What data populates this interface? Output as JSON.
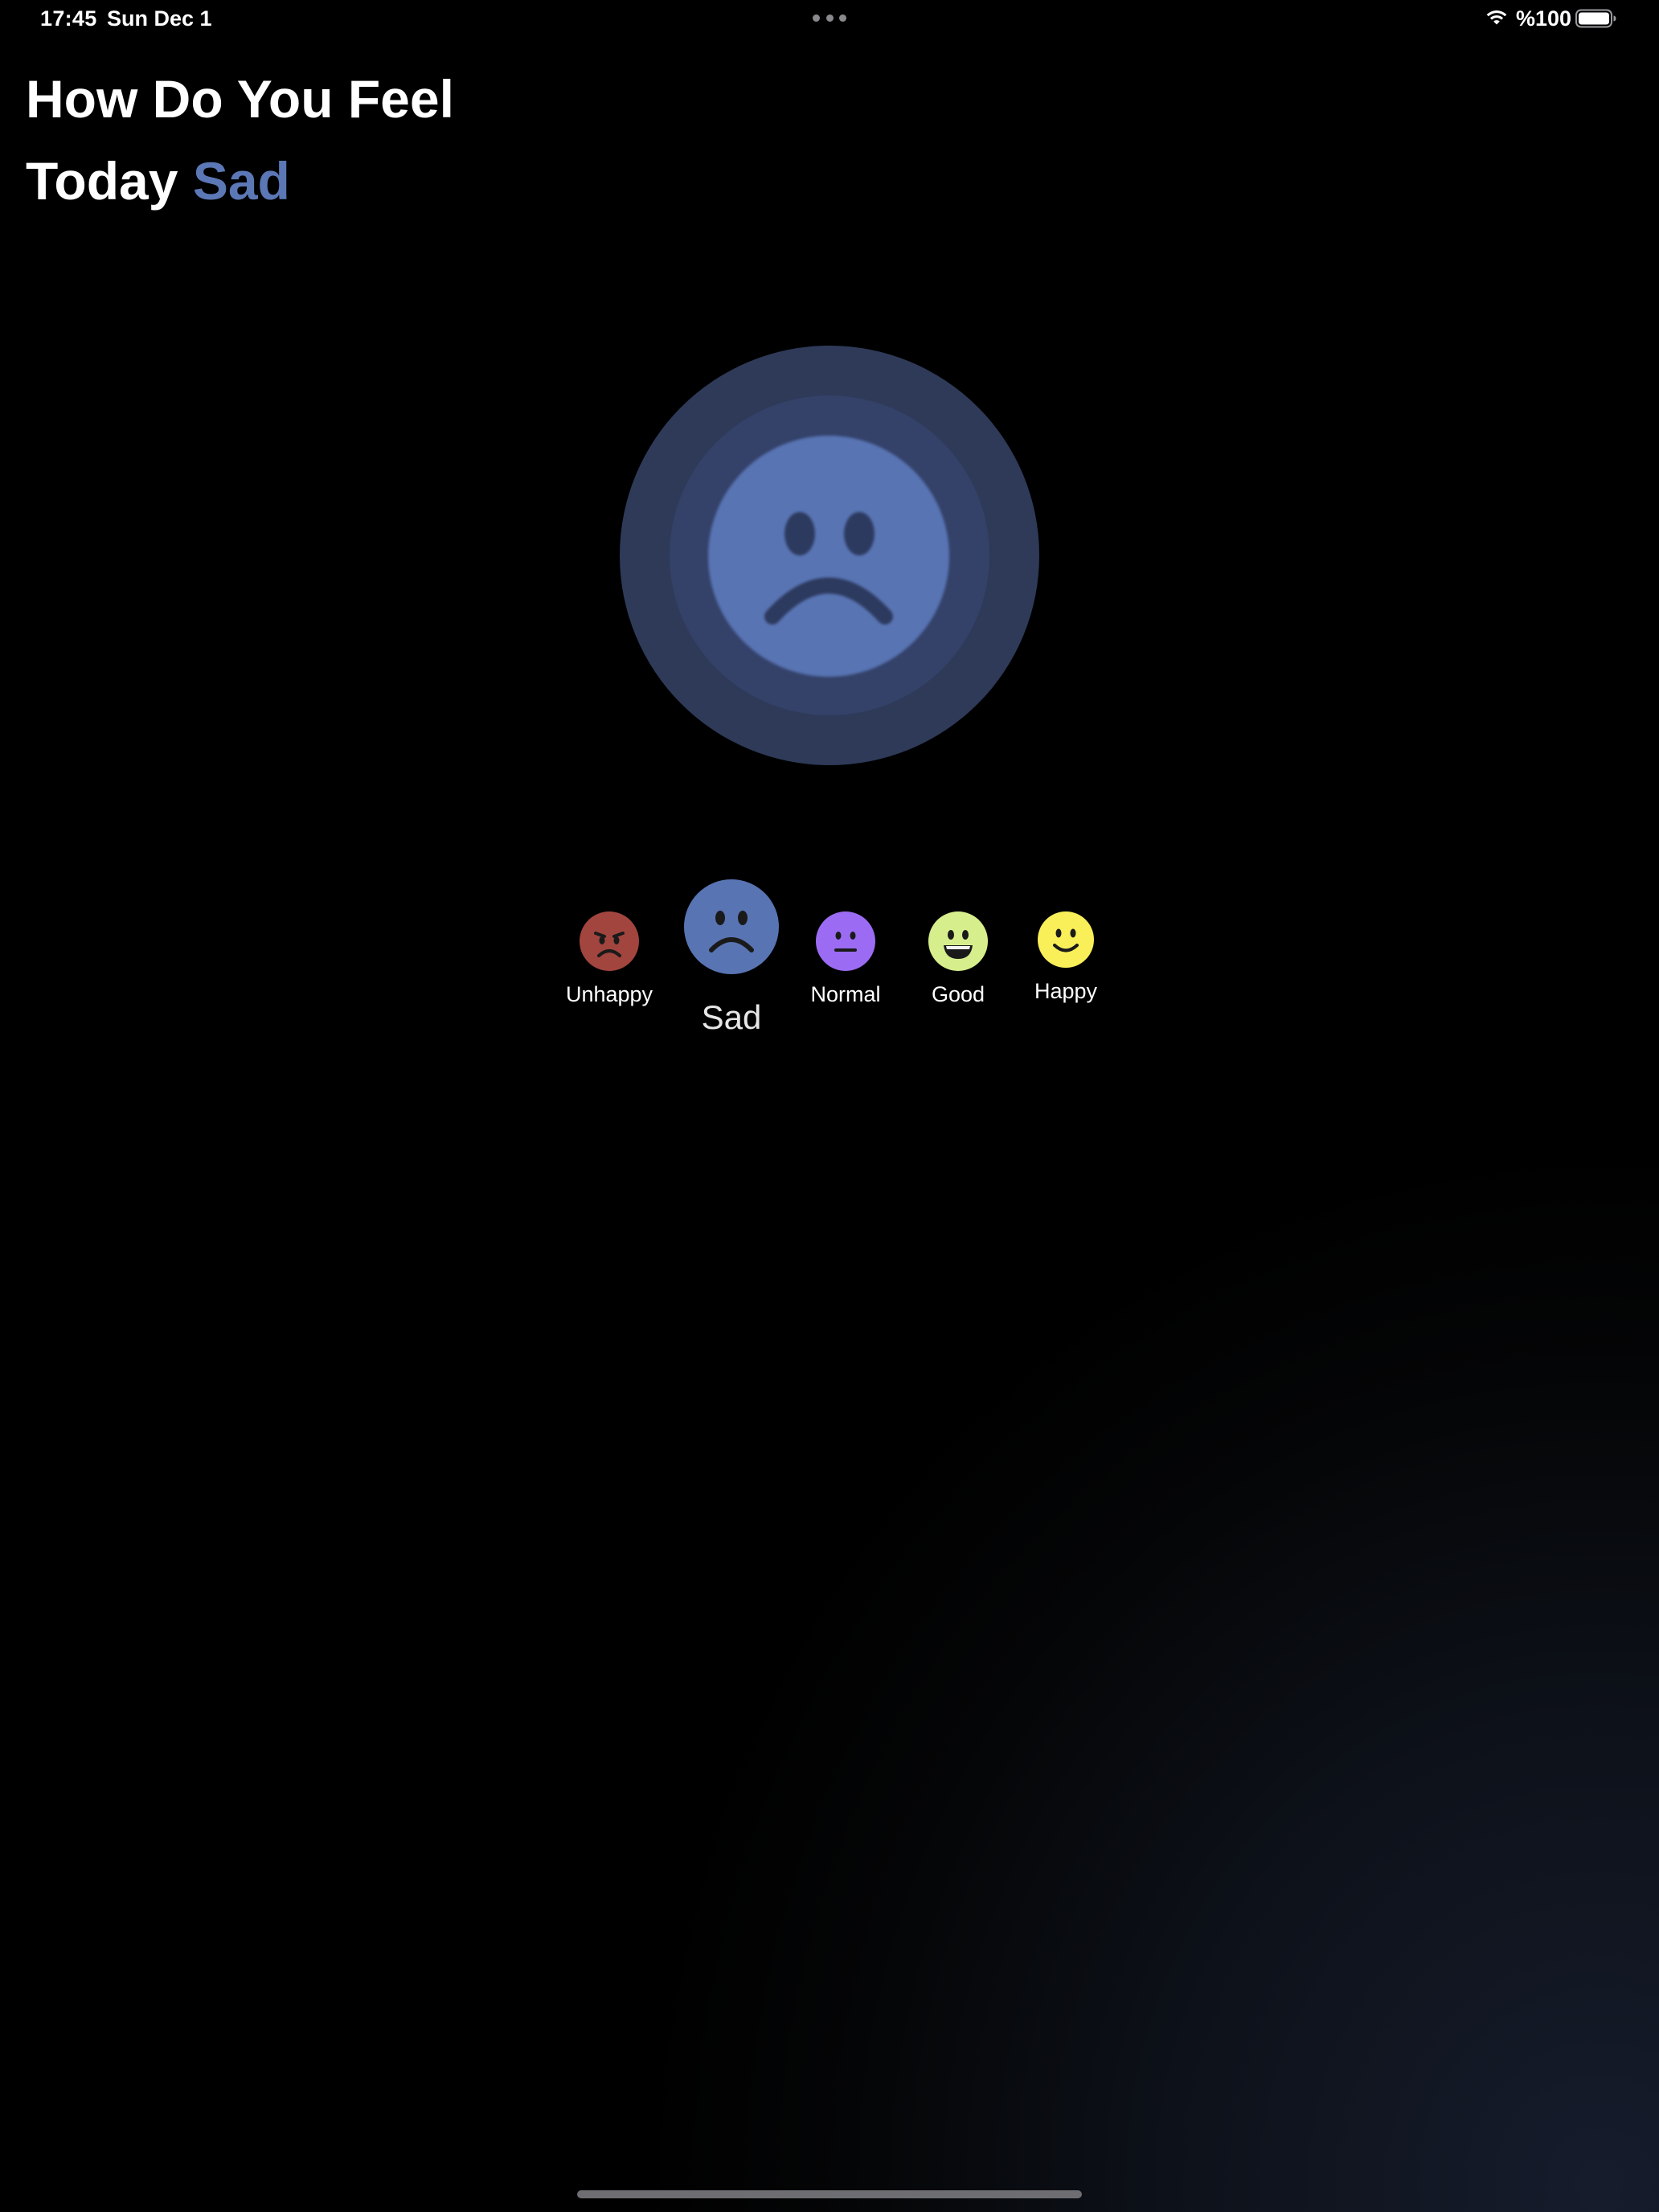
{
  "status_bar": {
    "time": "17:45",
    "date": "Sun Dec 1",
    "battery": "%100",
    "icons": [
      "multitasking-dots-icon",
      "wifi-icon",
      "battery-icon"
    ]
  },
  "header": {
    "title_line1": "How Do You Feel",
    "title_line2_prefix": "Today",
    "selected_mood": "Sad"
  },
  "colors": {
    "accent": "#5b77b5",
    "unhappy": "#a2453e",
    "sad": "#5874b3",
    "normal": "#9b6cf3",
    "good": "#d6ef8c",
    "happy": "#f9ef58"
  },
  "moods": [
    {
      "id": "unhappy",
      "label": "Unhappy",
      "icon": "angry-face-icon",
      "color": "#a2453e",
      "selected": false
    },
    {
      "id": "sad",
      "label": "Sad",
      "icon": "sad-face-icon",
      "color": "#5874b3",
      "selected": true
    },
    {
      "id": "normal",
      "label": "Normal",
      "icon": "neutral-face-icon",
      "color": "#9b6cf3",
      "selected": false
    },
    {
      "id": "good",
      "label": "Good",
      "icon": "grinning-face-icon",
      "color": "#d6ef8c",
      "selected": false
    },
    {
      "id": "happy",
      "label": "Happy",
      "icon": "smiling-face-icon",
      "color": "#f9ef58",
      "selected": false
    }
  ]
}
